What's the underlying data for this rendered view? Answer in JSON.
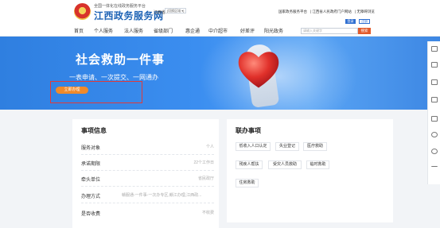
{
  "header": {
    "platform_subtitle": "全国一体化在线政务服务平台",
    "site_name": "江西政务服务网",
    "region": "江西省",
    "region_switch": "[切换区域 ▾]",
    "top_links": [
      "国家政务服务平台",
      "江西省人民政府门户网站",
      "无障碍浏览"
    ],
    "login_label": "登录",
    "register_label": "注册"
  },
  "nav": {
    "items": [
      "首页",
      "个人服务",
      "法人服务",
      "省级部门",
      "惠企通",
      "中介超市",
      "好差评",
      "阳光政务"
    ],
    "search_placeholder": "请输入关键字",
    "search_button": "搜索"
  },
  "banner": {
    "title": "社会救助一件事",
    "slogan": "一表申请、一次提交、一网通办",
    "cta_label": "立即办理"
  },
  "side_rail": {
    "items": [
      {
        "icon": "printer-icon",
        "label": ""
      },
      {
        "icon": "document-icon",
        "label": ""
      },
      {
        "icon": "chart-icon",
        "label": ""
      },
      {
        "icon": "hierarchy-icon",
        "label": ""
      },
      {
        "icon": "chat-icon",
        "label": ""
      },
      {
        "icon": "close-circle-icon",
        "label": ""
      },
      {
        "icon": "question-icon",
        "label": ""
      },
      {
        "icon": "back-to-top-icon",
        "label": ""
      }
    ]
  },
  "info_card": {
    "title": "事项信息",
    "rows": [
      {
        "key": "服务对象",
        "value": "个人"
      },
      {
        "key": "承诺期限",
        "value": "22个工作日"
      },
      {
        "key": "牵头单位",
        "value": "省民政厅"
      },
      {
        "key": "办理方式",
        "value": "赣服通-一件事-一次办专区,赣江办理,江西政..."
      },
      {
        "key": "是否收费",
        "value": "不收费"
      }
    ]
  },
  "links_card": {
    "title": "联办事项",
    "items": [
      "低收入人口认定",
      "失业登记",
      "医疗救助",
      "残疾人帮扶",
      "受灾人员救助",
      "临时救助",
      "住房救助"
    ]
  },
  "colors": {
    "brand_blue": "#1e63b5",
    "banner_blue": "#3b8ef0",
    "cta_orange": "#f08a2b",
    "search_orange": "#e25b2c",
    "highlight_red": "#e03a3a"
  }
}
